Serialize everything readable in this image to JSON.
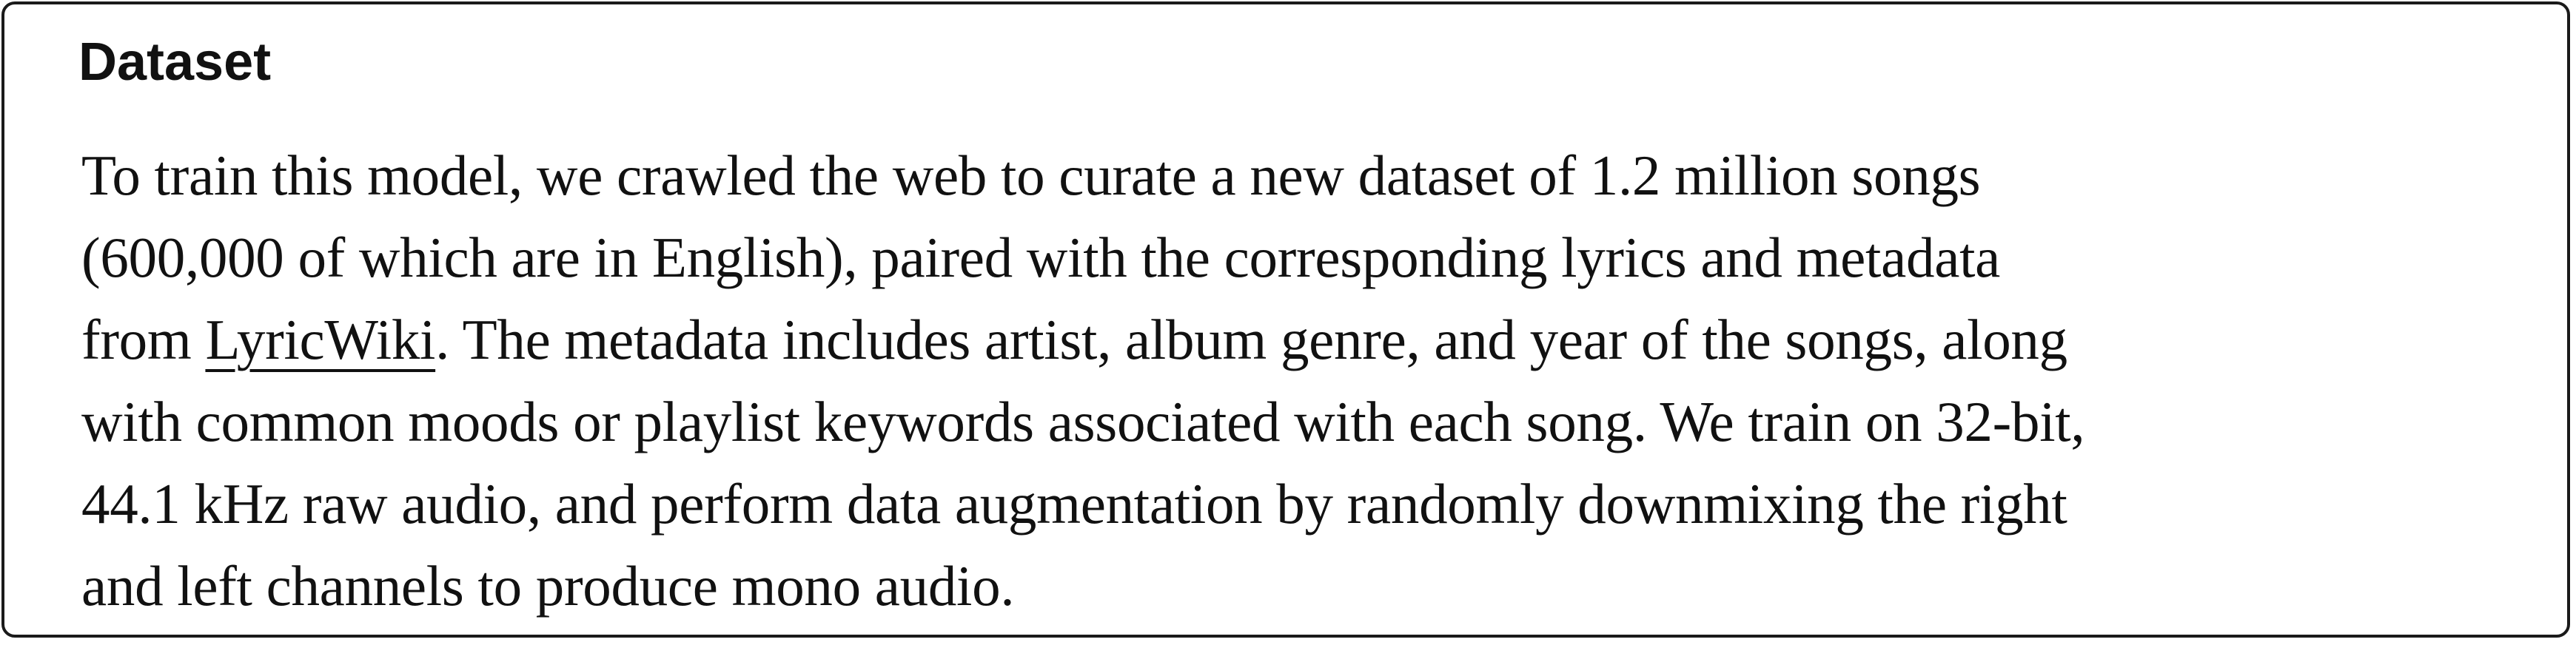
{
  "section": {
    "heading": "Dataset",
    "paragraph": {
      "line1": "To train this model, we crawled the web to curate a new dataset of 1.2 million songs",
      "line2": "(600,000 of which are in English), paired with the corresponding lyrics and metadata",
      "line3_before_link": "from ",
      "link_text": "LyricWiki",
      "line3_after_link": ". The metadata includes artist, album genre, and year of the songs, along",
      "line4": "with common moods or playlist keywords associated with each song. We train on 32-bit,",
      "line5": "44.1 kHz raw audio, and perform data augmentation by randomly downmixing the right",
      "line6": "and left channels to produce mono audio."
    }
  },
  "colors": {
    "text": "#111111",
    "border": "#1a1a1a",
    "background": "#ffffff"
  }
}
